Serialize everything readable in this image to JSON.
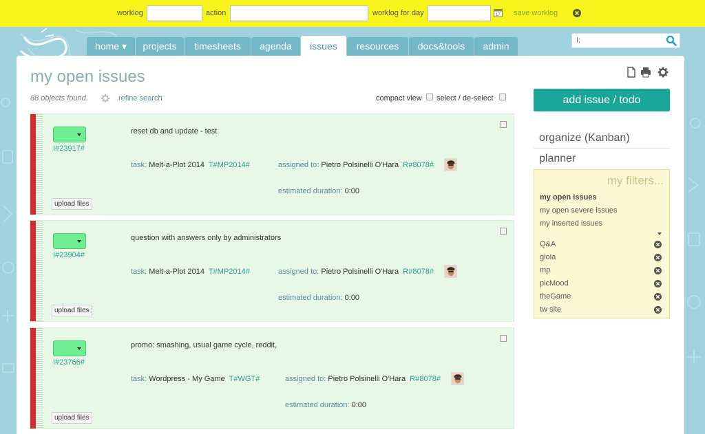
{
  "worklog": {
    "worklog_label": "worklog",
    "worklog_value": "",
    "action_label": "action",
    "action_value": "",
    "day_label": "worklog for day",
    "day_value": "",
    "save_label": "save worklog"
  },
  "nav": {
    "tabs": [
      {
        "label": "home ▾"
      },
      {
        "label": "projects"
      },
      {
        "label": "timesheets"
      },
      {
        "label": "agenda"
      },
      {
        "label": "issues",
        "active": true
      },
      {
        "label": "resources"
      },
      {
        "label": "docs&tools"
      },
      {
        "label": "admin"
      }
    ],
    "search_value": "I:"
  },
  "page": {
    "title": "my open issues",
    "found": "88 objects found.",
    "refine": "refine search",
    "compact_view": "compact view",
    "select_deselect": "select / de-select"
  },
  "issues": [
    {
      "code": "I#23917#",
      "description": "reset db and update - test",
      "task_label": "task:",
      "task_name": "Melt-a-Plot 2014",
      "task_code": "T#MP2014#",
      "assigned_label": "assigned to:",
      "assignee": "Pietro Polsinelli O'Hara",
      "assignee_code": "R#8078#",
      "duration_label": "estimated duration:",
      "duration": "0:00",
      "upload_label": "upload files"
    },
    {
      "code": "I#23904#",
      "description": "question with answers only by administrators",
      "task_label": "task:",
      "task_name": "Melt-a-Plot 2014",
      "task_code": "T#MP2014#",
      "assigned_label": "assigned to:",
      "assignee": "Pietro Polsinelli O'Hara",
      "assignee_code": "R#8078#",
      "duration_label": "estimated duration:",
      "duration": "0:00",
      "upload_label": "upload files"
    },
    {
      "code": "I#23766#",
      "description": "promo: smashing, usual game cycle, reddit,",
      "task_label": "task:",
      "task_name": "Wordpress - My Game",
      "task_code": "T#WGT#",
      "assigned_label": "assigned to:",
      "assignee": "Pietro Polsinelli O'Hara",
      "assignee_code": "R#8078#",
      "duration_label": "estimated duration:",
      "duration": "0:00",
      "upload_label": "upload files"
    }
  ],
  "sidebar": {
    "add_issue": "add issue / todo",
    "organize": "organize (Kanban)",
    "planner": "planner",
    "filters_title": "my filters...",
    "saved_filters": [
      "my open issues",
      "my open severe issues",
      "my inserted issues"
    ],
    "tag_filters": [
      "Q&A",
      "gioia",
      "mp",
      "picMood",
      "theGame",
      "tw site"
    ]
  },
  "colors": {
    "topbar": "#f6f41a",
    "accent": "#1aa79a",
    "priority_bar": "#d22d2d",
    "status_green": "#6ef092",
    "card_bg": "#e8f8e6"
  },
  "icons": {
    "toolbar": [
      "new-document-icon",
      "print-icon",
      "settings-gear-icon"
    ],
    "search": "magnifier-icon",
    "calendar": "calendar-icon",
    "close": "close-circle-icon"
  }
}
